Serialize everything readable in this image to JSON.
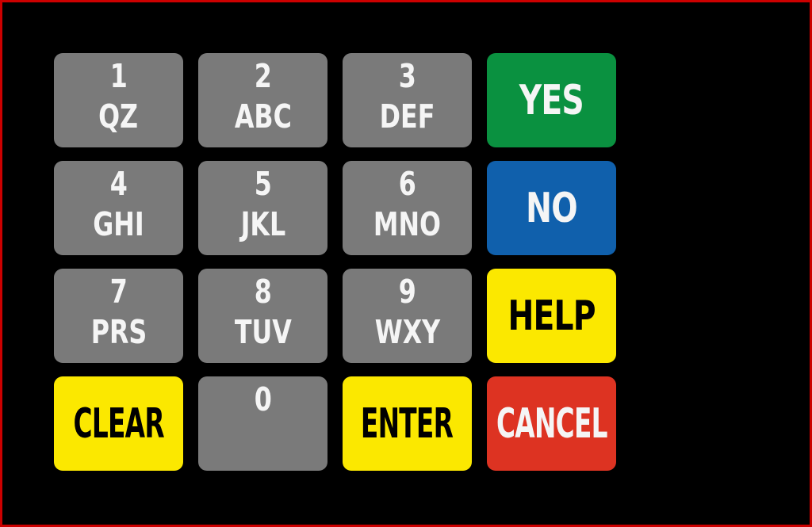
{
  "screen": {
    "name": "fuel-dispenser-pinpad",
    "background_color": "#000000",
    "border_color": "#cc0000"
  },
  "palette": {
    "key_gray": "#7a7a7a",
    "yes_green": "#0a9140",
    "no_blue": "#1060ac",
    "yellow": "#fbe800",
    "cancel_red": "#dd3322",
    "light_text": "#f5f5f5",
    "dark_text": "#000000"
  },
  "keypad": {
    "rows": [
      [
        {
          "id": "key-1",
          "type": "digit",
          "digit": "1",
          "letters": "QZ",
          "bg": "#7a7a7a",
          "fg": "#f5f5f5"
        },
        {
          "id": "key-2",
          "type": "digit",
          "digit": "2",
          "letters": "ABC",
          "bg": "#7a7a7a",
          "fg": "#f5f5f5"
        },
        {
          "id": "key-3",
          "type": "digit",
          "digit": "3",
          "letters": "DEF",
          "bg": "#7a7a7a",
          "fg": "#f5f5f5"
        },
        {
          "id": "key-yes",
          "type": "function",
          "label": "YES",
          "bg": "#0a9140",
          "fg": "#f5f5f5"
        }
      ],
      [
        {
          "id": "key-4",
          "type": "digit",
          "digit": "4",
          "letters": "GHI",
          "bg": "#7a7a7a",
          "fg": "#f5f5f5"
        },
        {
          "id": "key-5",
          "type": "digit",
          "digit": "5",
          "letters": "JKL",
          "bg": "#7a7a7a",
          "fg": "#f5f5f5"
        },
        {
          "id": "key-6",
          "type": "digit",
          "digit": "6",
          "letters": "MNO",
          "bg": "#7a7a7a",
          "fg": "#f5f5f5"
        },
        {
          "id": "key-no",
          "type": "function",
          "label": "NO",
          "bg": "#1060ac",
          "fg": "#f5f5f5"
        }
      ],
      [
        {
          "id": "key-7",
          "type": "digit",
          "digit": "7",
          "letters": "PRS",
          "bg": "#7a7a7a",
          "fg": "#f5f5f5"
        },
        {
          "id": "key-8",
          "type": "digit",
          "digit": "8",
          "letters": "TUV",
          "bg": "#7a7a7a",
          "fg": "#f5f5f5"
        },
        {
          "id": "key-9",
          "type": "digit",
          "digit": "9",
          "letters": "WXY",
          "bg": "#7a7a7a",
          "fg": "#f5f5f5"
        },
        {
          "id": "key-help",
          "type": "function",
          "label": "HELP",
          "bg": "#fbe800",
          "fg": "#000000"
        }
      ],
      [
        {
          "id": "key-clear",
          "type": "function",
          "label": "CLEAR",
          "bg": "#fbe800",
          "fg": "#000000",
          "wide": true
        },
        {
          "id": "key-0",
          "type": "zero",
          "digit": "0",
          "letters": "",
          "bg": "#7a7a7a",
          "fg": "#f5f5f5"
        },
        {
          "id": "key-enter",
          "type": "function",
          "label": "ENTER",
          "bg": "#fbe800",
          "fg": "#000000",
          "wide": true
        },
        {
          "id": "key-cancel",
          "type": "function",
          "label": "CANCEL",
          "bg": "#dd3322",
          "fg": "#f5f5f5",
          "wide": true
        }
      ]
    ]
  }
}
